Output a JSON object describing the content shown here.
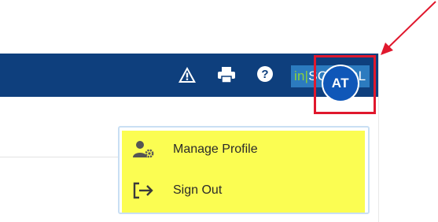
{
  "header": {
    "background_color": "#0e3f7d",
    "icons": [
      {
        "name": "warning-icon"
      },
      {
        "name": "print-icon"
      },
      {
        "name": "help-icon"
      }
    ],
    "brand": {
      "prefix": "in",
      "separator": "|",
      "suffix": "SCHOOL"
    },
    "avatar": {
      "initials": "AT",
      "color": "#0f57b8"
    },
    "highlight_color": "#e0182d"
  },
  "menu": {
    "highlight_color": "#fbfd52",
    "items": [
      {
        "label": "Manage Profile",
        "icon": "manage-profile-icon"
      },
      {
        "label": "Sign Out",
        "icon": "sign-out-icon"
      }
    ]
  }
}
